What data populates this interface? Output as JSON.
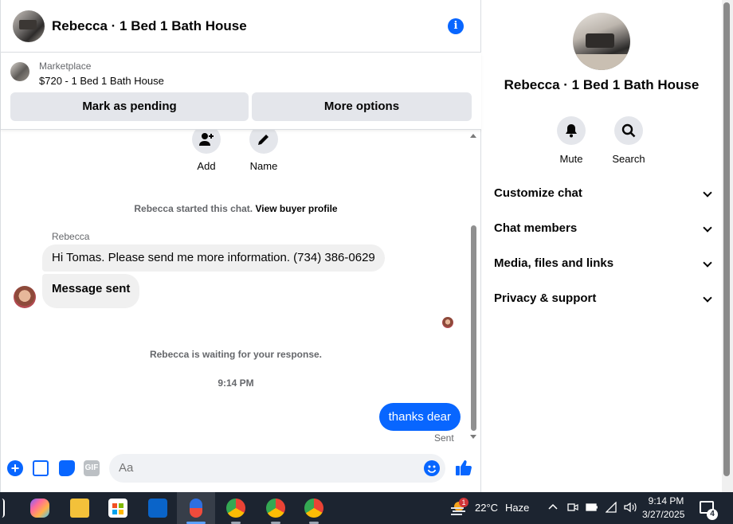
{
  "header": {
    "title": "Rebecca · 1 Bed 1 Bath House"
  },
  "listing": {
    "label": "Marketplace",
    "price_title": "$720 - 1 Bed 1 Bath House",
    "pending_button": "Mark as pending",
    "more_button": "More options"
  },
  "quick_actions": {
    "add": "Add",
    "name": "Name"
  },
  "messages": {
    "started_prefix": "Rebecca started this chat.",
    "started_link": "View buyer profile",
    "sender": "Rebecca",
    "msg1": "Hi Tomas. Please send me more information. (734) 386-0629",
    "msg2": "Message sent",
    "waiting": "Rebecca is waiting for your response.",
    "time": "9:14 PM",
    "mine": "thanks dear",
    "status": "Sent"
  },
  "composer": {
    "placeholder": "Aa",
    "gif": "GIF"
  },
  "info": {
    "name": "Rebecca · 1 Bed 1 Bath House",
    "mute": "Mute",
    "search": "Search",
    "sections": [
      "Customize chat",
      "Chat members",
      "Media, files and links",
      "Privacy & support"
    ]
  },
  "taskbar": {
    "temp": "22°C",
    "condition": "Haze",
    "weather_badge": "1",
    "time": "9:14 PM",
    "date": "3/27/2025",
    "notifications": "4"
  },
  "colors": {
    "accent": "#0866ff",
    "bubble": "#f0f0f0",
    "taskbar": "#1c2430"
  }
}
